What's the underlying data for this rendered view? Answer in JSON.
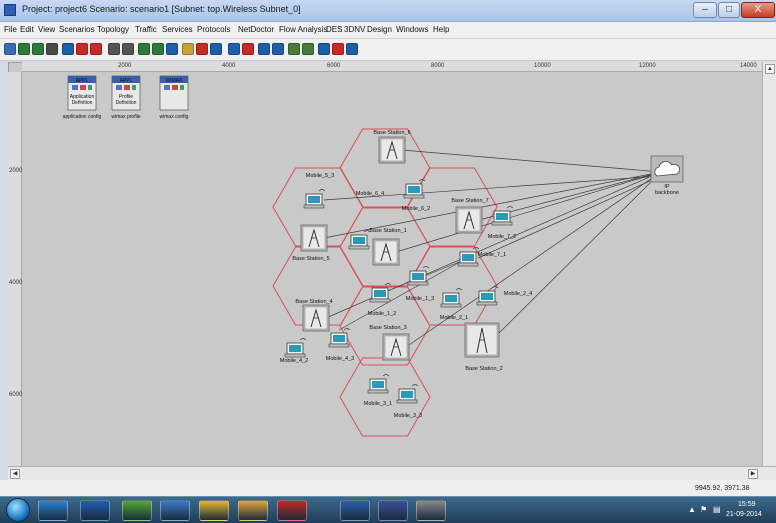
{
  "window": {
    "title": "Project: project6 Scenario: scenario1  [Subnet: top.Wireless Subnet_0]",
    "controls": {
      "minimize": "–",
      "maximize": "□",
      "close": "X"
    }
  },
  "menu": {
    "items": [
      "File",
      "Edit",
      "View",
      "Scenarios",
      "Topology",
      "Traffic",
      "Services",
      "Protocols",
      "NetDoctor",
      "Flow Analysis",
      "DES",
      "3DNV",
      "Design",
      "Windows",
      "Help"
    ]
  },
  "toolbar": {
    "icons": [
      "open-folder",
      "save",
      "save-all",
      "print",
      "cut",
      "stop",
      "stop",
      "zoom-in",
      "zoom-out",
      "node-a",
      "node-b",
      "node-c",
      "node-d",
      "node-e",
      "node-f",
      "node-g",
      "node-h",
      "node-i",
      "node-j",
      "node-k",
      "node-l",
      "node-m",
      "node-n",
      "node-o"
    ],
    "colors": [
      "#3c6bb0",
      "#2f7a3a",
      "#2f7a3a",
      "#4a4a4a",
      "#1f5fa8",
      "#c82a2a",
      "#c82a2a",
      "#555555",
      "#555555",
      "#2f7a3a",
      "#2f7a3a",
      "#1f5fa8",
      "#c4a23a",
      "#c82a2a",
      "#1f5fa8",
      "#1f5fa8",
      "#c82a2a",
      "#1f5fa8",
      "#1f5fa8",
      "#4a7a3a",
      "#4a7a3a",
      "#1f5fa8",
      "#c82a2a",
      "#1f5fa8"
    ]
  },
  "rulers": {
    "top": [
      "2000",
      "4000",
      "6000",
      "8000",
      "10000",
      "12000",
      "14000"
    ],
    "left": [
      "2000",
      "4000",
      "6000"
    ]
  },
  "config_objects": [
    {
      "header": "APPL",
      "line1": "Application",
      "line2": "Definition",
      "caption": "application config"
    },
    {
      "header": "APPL",
      "line1": "Profile",
      "line2": "Definition",
      "caption": "wimax profile"
    },
    {
      "header": "WiMAX",
      "line1": "",
      "line2": "",
      "caption": "wimax config"
    }
  ],
  "cloud": {
    "name": "IP",
    "caption": "backbone"
  },
  "base_stations": [
    {
      "label": "Base Station_6"
    },
    {
      "label": "Base Station_7"
    },
    {
      "label": "Base Station_1"
    },
    {
      "label": "Base Station_5"
    },
    {
      "label": "Base Station_4"
    },
    {
      "label": "Base Station_3"
    },
    {
      "label": "Base Station_2"
    }
  ],
  "mobiles": [
    {
      "label": "Mobile_5_3"
    },
    {
      "label": "Mobile_6_4"
    },
    {
      "label": "Mobile_6_2"
    },
    {
      "label": "Mobile_7_2"
    },
    {
      "label": "Mobile_7_1"
    },
    {
      "label": "Mobile_1_3"
    },
    {
      "label": "Mobile_1_2"
    },
    {
      "label": "Mobile_2_1"
    },
    {
      "label": "Mobile_2_4"
    },
    {
      "label": "Mobile_4_2"
    },
    {
      "label": "Mobile_4_3"
    },
    {
      "label": "Mobile_3_1"
    },
    {
      "label": "Mobile_3_3"
    }
  ],
  "status": {
    "coords": "9945.92, 3971.38"
  },
  "taskbar": {
    "apps": [
      "ie",
      "bluetooth",
      "utorrent",
      "paint",
      "chrome",
      "explorer",
      "acrobat",
      "word",
      "opnet",
      "media"
    ],
    "app_colors": [
      "#2a83d6",
      "#1c5fb3",
      "#52a83a",
      "#3a7bc8",
      "#e1b830",
      "#e0a63a",
      "#c52828",
      "#2b5fae",
      "#3a4fa0",
      "#8a8a8a"
    ],
    "time": "15:59",
    "date": "21-09-2014"
  }
}
